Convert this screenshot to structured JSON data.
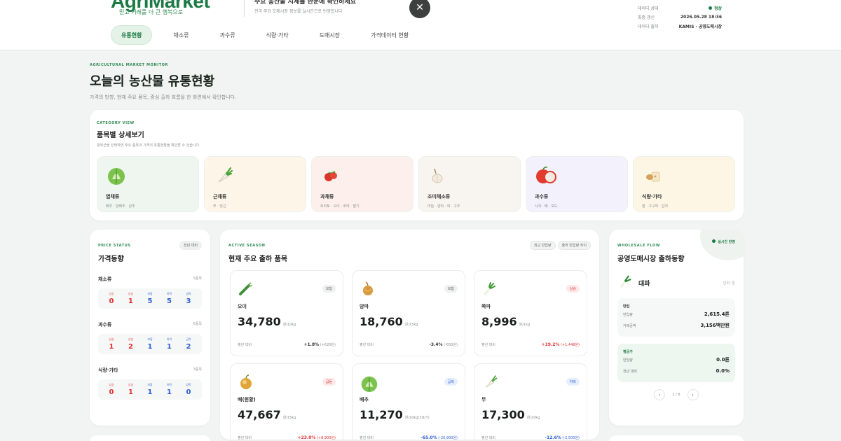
{
  "header": {
    "logo": "AgriMarket",
    "logo_sub": "믿고 거래를 더 큰 행복으로",
    "banner_title": "주요 농산물 시세를 한눈에 확인하세요",
    "banner_sub": "전국 주요 도매시장 정보를 실시간으로 반영합니다",
    "meta": [
      {
        "label": "데이터 상태",
        "value": "정상",
        "live": true
      },
      {
        "label": "최종 갱신",
        "value": "2026.05.28 18:36"
      },
      {
        "label": "데이터 출처",
        "value": "KAMIS · 공영도매시장"
      }
    ],
    "nav": [
      "유통현황",
      "채소류",
      "과수류",
      "식량·가타",
      "도매시장",
      "가격데이터 현황"
    ],
    "active_nav": 0
  },
  "hero": {
    "eyebrow": "AGRICULTURAL MARKET MONITOR",
    "title": "오늘의 농산물 유통현황",
    "subtitle": "가격의 방향, 현재 주요 품목, 중심 출하 흐름을 한 화면에서 확인합니다."
  },
  "category": {
    "eyebrow": "CATEGORY VIEW",
    "title": "품목별 상세보기",
    "subtitle": "항목군을 선택하면 주요 품목과 가격의 유통현황을 확인할 수 있습니다.",
    "items": [
      {
        "name": "엽채류",
        "tags": "배추 · 양배추 · 상추",
        "icon": "cabbage-icon",
        "bg": "#eef6ef"
      },
      {
        "name": "근채류",
        "tags": "무 · 당근",
        "icon": "radish-icon",
        "bg": "#fdf6e8"
      },
      {
        "name": "과채류",
        "tags": "토마토 · 오이 · 호박 · 딸기",
        "icon": "strawberry-icon",
        "bg": "#fdf0ec"
      },
      {
        "name": "조미채소류",
        "tags": "마늘 · 양파 · 파 · 고추",
        "icon": "garlic-icon",
        "bg": "#f8f5f1"
      },
      {
        "name": "과수류",
        "tags": "사과 · 배 · 포도",
        "icon": "apple-icon",
        "bg": "#f3f1fc"
      },
      {
        "name": "식량·가타",
        "tags": "쌀 · 고구마 · 감자",
        "icon": "grain-icon",
        "bg": "#fdf6e5"
      }
    ]
  },
  "price": {
    "eyebrow": "PRICE STATUS",
    "title": "가격동향",
    "pill": "전년 대비",
    "groups": [
      {
        "name": "채소류",
        "note": "5품목",
        "cells": [
          {
            "label": "상승",
            "value": "0",
            "tone": "red"
          },
          {
            "label": "상승",
            "value": "1",
            "tone": "red"
          },
          {
            "label": "보합",
            "value": "5",
            "tone": "blue"
          },
          {
            "label": "하락",
            "value": "5",
            "tone": "blue"
          },
          {
            "label": "급락",
            "value": "3",
            "tone": "blue"
          }
        ]
      },
      {
        "name": "과수류",
        "note": "6품목",
        "cells": [
          {
            "label": "상승",
            "value": "1",
            "tone": "red"
          },
          {
            "label": "상승",
            "value": "2",
            "tone": "red"
          },
          {
            "label": "보합",
            "value": "1",
            "tone": "blue"
          },
          {
            "label": "하락",
            "value": "1",
            "tone": "blue"
          },
          {
            "label": "급락",
            "value": "2",
            "tone": "blue"
          }
        ]
      },
      {
        "name": "식량·가타",
        "note": "3품목",
        "cells": [
          {
            "label": "상승",
            "value": "0",
            "tone": "red"
          },
          {
            "label": "상승",
            "value": "1",
            "tone": "red"
          },
          {
            "label": "보합",
            "value": "1",
            "tone": "blue"
          },
          {
            "label": "하락",
            "value": "1",
            "tone": "blue"
          },
          {
            "label": "급락",
            "value": "0",
            "tone": "blue"
          }
        ]
      }
    ]
  },
  "season": {
    "eyebrow": "ACTIVE SEASON",
    "title": "현재 주요 출하 품목",
    "pills": [
      "최근 반입량",
      "출하 반입량 추이"
    ],
    "items": [
      {
        "name": "오이",
        "price": "34,780",
        "unit": "원/10kg",
        "badge": "보합",
        "badge_tone": "g",
        "icon": "cucumber-icon",
        "foot": "평년 대비",
        "change": "+1.8%",
        "change_tone": "dark",
        "change_note": "(+620원)"
      },
      {
        "name": "양파",
        "price": "18,760",
        "unit": "원/15kg",
        "badge": "보합",
        "badge_tone": "g",
        "icon": "onion-icon",
        "foot": "평년 대비",
        "change": "-3.4%",
        "change_tone": "dark",
        "change_note": "(-650원)"
      },
      {
        "name": "쪽파",
        "price": "8,996",
        "unit": "원/1kg",
        "badge": "상승",
        "badge_tone": "r",
        "icon": "scallion-icon",
        "foot": "평년 대비",
        "change": "+19.2%",
        "change_tone": "red",
        "change_note": "(+1,448원)"
      },
      {
        "name": "배(원황)",
        "price": "47,667",
        "unit": "원/15kg",
        "badge": "급등",
        "badge_tone": "r",
        "icon": "pear-icon",
        "foot": "평년 대비",
        "change": "+23.0%",
        "change_tone": "red",
        "change_note": "(+8,900원)"
      },
      {
        "name": "배추",
        "price": "11,270",
        "unit": "원/10kg(3포기)",
        "badge": "급락",
        "badge_tone": "bl",
        "icon": "cabbage-icon",
        "foot": "평년 대비",
        "change": "-65.0%",
        "change_tone": "blue",
        "change_note": "(-20,900원)"
      },
      {
        "name": "무",
        "price": "17,300",
        "unit": "원/20kg",
        "badge": "하락",
        "badge_tone": "bl",
        "icon": "radish-icon",
        "foot": "평년 대비",
        "change": "-12.6%",
        "change_tone": "blue",
        "change_note": "(-2,500원)"
      }
    ]
  },
  "wholesale": {
    "eyebrow": "WHOLESALE FLOW",
    "title": "공영도매시장 출하동향",
    "live": "실시간 반영",
    "item_name": "대파",
    "item_unit": "단위: 톤",
    "item_icon": "leek-icon",
    "box1": {
      "head": "반입",
      "rows": [
        {
          "label": "반입량",
          "value": "2,615.4톤"
        },
        {
          "label": "거래금액",
          "value": "3,156백만원"
        }
      ]
    },
    "box2": {
      "head": "평균가",
      "rows": [
        {
          "label": "반입량",
          "value": "0.0톤"
        },
        {
          "label": "전년 대비",
          "value": "0.0%"
        }
      ]
    },
    "pager": {
      "prev": "‹",
      "label": "1 / 6",
      "next": "›"
    }
  }
}
